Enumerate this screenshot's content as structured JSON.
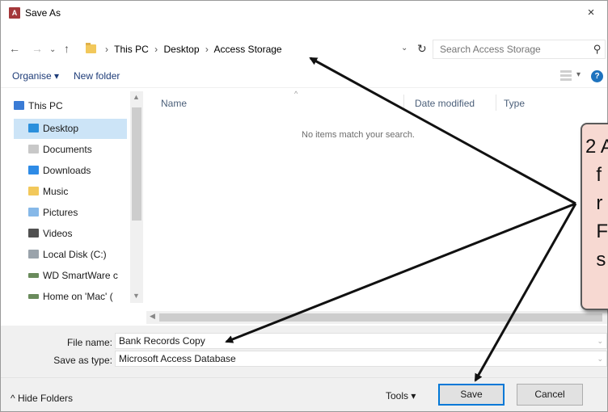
{
  "window": {
    "title": "Save As",
    "app_icon": "access-app-icon",
    "close_glyph": "×"
  },
  "nav": {
    "back_glyph": "←",
    "forward_glyph": "→",
    "recent_glyph": "⌄",
    "up_glyph": "↑"
  },
  "address": {
    "crumbs": [
      "This PC",
      "Desktop",
      "Access Storage"
    ],
    "separator": "›",
    "dropdown_glyph": "⌄",
    "refresh_glyph": "↻"
  },
  "search": {
    "placeholder": "Search Access Storage"
  },
  "toolbar": {
    "organise_label": "Organise ▾",
    "new_folder_label": "New folder",
    "view_dropdown_glyph": "▾",
    "help_glyph": "?"
  },
  "navigation_pane": {
    "items": [
      {
        "label": "This PC",
        "icon": "this-pc-icon",
        "selected": false
      },
      {
        "label": "Desktop",
        "icon": "desktop-icon",
        "selected": true
      },
      {
        "label": "Documents",
        "icon": "documents-icon",
        "selected": false
      },
      {
        "label": "Downloads",
        "icon": "downloads-icon",
        "selected": false
      },
      {
        "label": "Music",
        "icon": "music-icon",
        "selected": false
      },
      {
        "label": "Pictures",
        "icon": "pictures-icon",
        "selected": false
      },
      {
        "label": "Videos",
        "icon": "videos-icon",
        "selected": false
      },
      {
        "label": "Local Disk (C:)",
        "icon": "local-disk-icon",
        "selected": false
      },
      {
        "label": "WD SmartWare c",
        "icon": "network-drive-icon",
        "selected": false
      },
      {
        "label": "Home on 'Mac' (",
        "icon": "network-drive-icon",
        "selected": false
      }
    ]
  },
  "file_list": {
    "columns": [
      "Name",
      "Date modified",
      "Type"
    ],
    "empty_message": "No items match your search."
  },
  "form": {
    "file_name_label": "File name:",
    "file_name_value": "Bank Records Copy",
    "save_as_type_label": "Save as type:",
    "save_as_type_value": "Microsoft Access Database",
    "dropdown_glyph": "⌄"
  },
  "footer": {
    "hide_folders_label": "^ Hide Folders",
    "tools_label": "Tools ▾",
    "save_label": "Save",
    "cancel_label": "Cancel"
  },
  "callout": {
    "lines": [
      "2 A",
      "  f",
      "  r",
      "  F",
      "  s"
    ],
    "fill_color": "#f7d9d2"
  },
  "colors": {
    "selection": "#cce4f7",
    "accent": "#0078d7",
    "link": "#1e3c78"
  }
}
